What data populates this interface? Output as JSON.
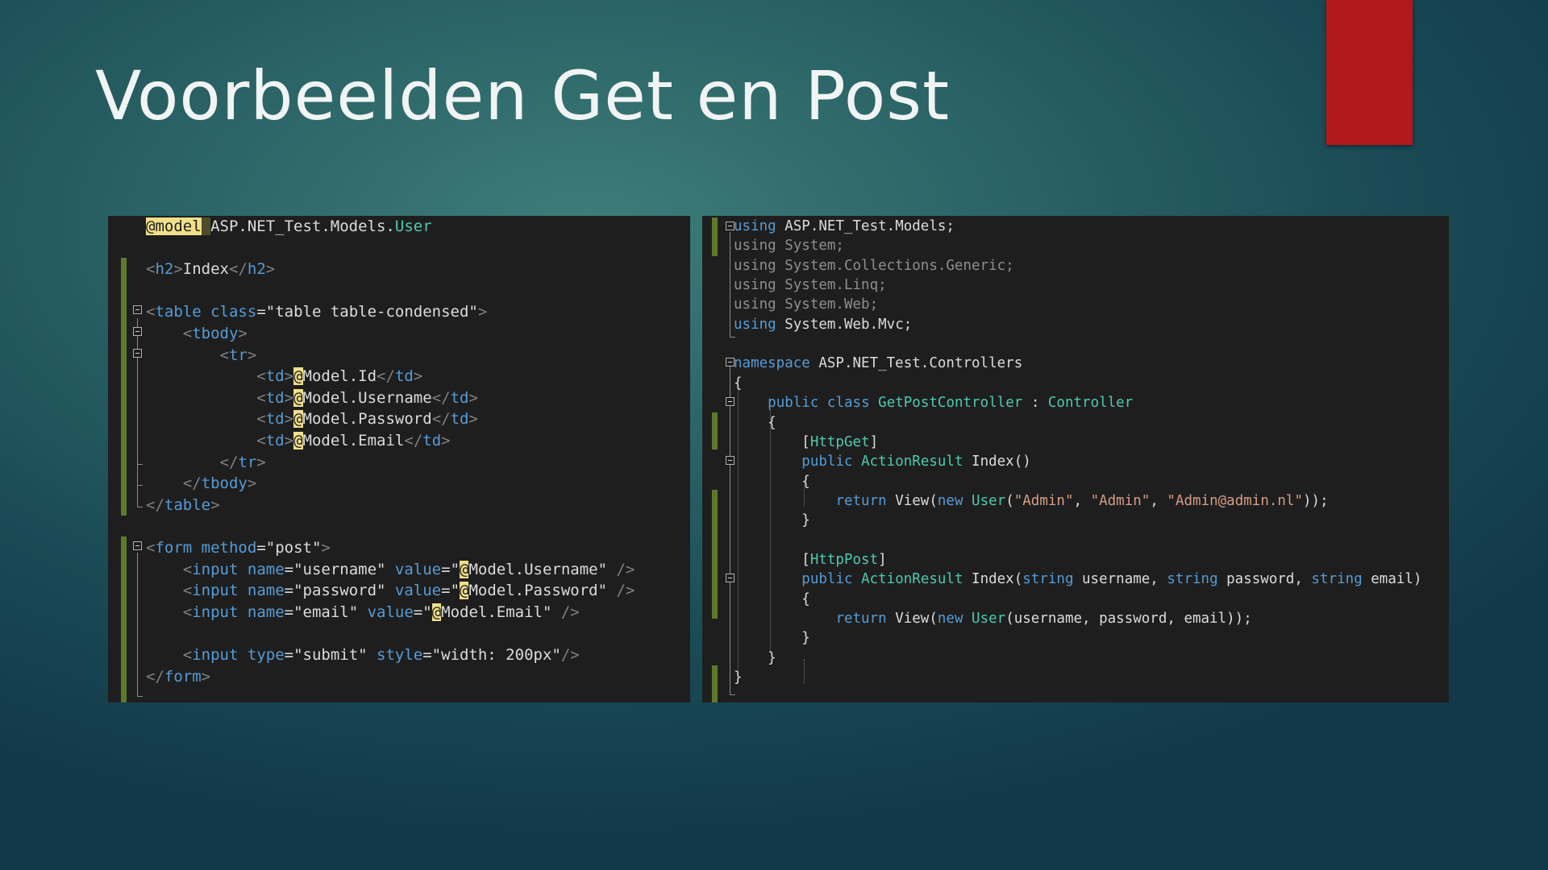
{
  "slide": {
    "title": "Voorbeelden Get en Post"
  },
  "left_code": {
    "lines": [
      {
        "segments": [
          {
            "t": "@model",
            "c": "hl-at"
          },
          {
            "t": " ",
            "c": "hl"
          },
          {
            "t": "ASP.NET_Test.Models.",
            "c": ""
          },
          {
            "t": "User",
            "c": "cls"
          }
        ]
      },
      {
        "segments": []
      },
      {
        "segments": [
          {
            "t": "<",
            "c": "tg"
          },
          {
            "t": "h2",
            "c": "kw"
          },
          {
            "t": ">",
            "c": "tg"
          },
          {
            "t": "Index",
            "c": ""
          },
          {
            "t": "</",
            "c": "tg"
          },
          {
            "t": "h2",
            "c": "kw"
          },
          {
            "t": ">",
            "c": "tg"
          }
        ]
      },
      {
        "segments": []
      },
      {
        "segments": [
          {
            "t": "<",
            "c": "tg"
          },
          {
            "t": "table",
            "c": "kw"
          },
          {
            "t": " ",
            "c": ""
          },
          {
            "t": "class",
            "c": "kw"
          },
          {
            "t": "=\"table table-condensed\"",
            "c": ""
          },
          {
            "t": ">",
            "c": "tg"
          }
        ]
      },
      {
        "segments": [
          {
            "t": "    ",
            "c": ""
          },
          {
            "t": "<",
            "c": "tg"
          },
          {
            "t": "tbody",
            "c": "kw"
          },
          {
            "t": ">",
            "c": "tg"
          }
        ]
      },
      {
        "segments": [
          {
            "t": "        ",
            "c": ""
          },
          {
            "t": "<",
            "c": "tg"
          },
          {
            "t": "tr",
            "c": "kw"
          },
          {
            "t": ">",
            "c": "tg"
          }
        ]
      },
      {
        "segments": [
          {
            "t": "            ",
            "c": ""
          },
          {
            "t": "<",
            "c": "tg"
          },
          {
            "t": "td",
            "c": "kw"
          },
          {
            "t": ">",
            "c": "tg"
          },
          {
            "t": "@",
            "c": "hl-at"
          },
          {
            "t": "Model.Id",
            "c": ""
          },
          {
            "t": "</",
            "c": "tg"
          },
          {
            "t": "td",
            "c": "kw"
          },
          {
            "t": ">",
            "c": "tg"
          }
        ]
      },
      {
        "segments": [
          {
            "t": "            ",
            "c": ""
          },
          {
            "t": "<",
            "c": "tg"
          },
          {
            "t": "td",
            "c": "kw"
          },
          {
            "t": ">",
            "c": "tg"
          },
          {
            "t": "@",
            "c": "hl-at"
          },
          {
            "t": "Model.Username",
            "c": ""
          },
          {
            "t": "</",
            "c": "tg"
          },
          {
            "t": "td",
            "c": "kw"
          },
          {
            "t": ">",
            "c": "tg"
          }
        ]
      },
      {
        "segments": [
          {
            "t": "            ",
            "c": ""
          },
          {
            "t": "<",
            "c": "tg"
          },
          {
            "t": "td",
            "c": "kw"
          },
          {
            "t": ">",
            "c": "tg"
          },
          {
            "t": "@",
            "c": "hl-at"
          },
          {
            "t": "Model.Password",
            "c": ""
          },
          {
            "t": "</",
            "c": "tg"
          },
          {
            "t": "td",
            "c": "kw"
          },
          {
            "t": ">",
            "c": "tg"
          }
        ]
      },
      {
        "segments": [
          {
            "t": "            ",
            "c": ""
          },
          {
            "t": "<",
            "c": "tg"
          },
          {
            "t": "td",
            "c": "kw"
          },
          {
            "t": ">",
            "c": "tg"
          },
          {
            "t": "@",
            "c": "hl-at"
          },
          {
            "t": "Model.Email",
            "c": ""
          },
          {
            "t": "</",
            "c": "tg"
          },
          {
            "t": "td",
            "c": "kw"
          },
          {
            "t": ">",
            "c": "tg"
          }
        ]
      },
      {
        "segments": [
          {
            "t": "        ",
            "c": ""
          },
          {
            "t": "</",
            "c": "tg"
          },
          {
            "t": "tr",
            "c": "kw"
          },
          {
            "t": ">",
            "c": "tg"
          }
        ]
      },
      {
        "segments": [
          {
            "t": "    ",
            "c": ""
          },
          {
            "t": "</",
            "c": "tg"
          },
          {
            "t": "tbody",
            "c": "kw"
          },
          {
            "t": ">",
            "c": "tg"
          }
        ]
      },
      {
        "segments": [
          {
            "t": "</",
            "c": "tg"
          },
          {
            "t": "table",
            "c": "kw"
          },
          {
            "t": ">",
            "c": "tg"
          }
        ]
      },
      {
        "segments": []
      },
      {
        "segments": [
          {
            "t": "<",
            "c": "tg"
          },
          {
            "t": "form",
            "c": "kw"
          },
          {
            "t": " ",
            "c": ""
          },
          {
            "t": "method",
            "c": "kw"
          },
          {
            "t": "=\"post\"",
            "c": ""
          },
          {
            "t": ">",
            "c": "tg"
          }
        ]
      },
      {
        "segments": [
          {
            "t": "    ",
            "c": ""
          },
          {
            "t": "<",
            "c": "tg"
          },
          {
            "t": "input",
            "c": "kw"
          },
          {
            "t": " ",
            "c": ""
          },
          {
            "t": "name",
            "c": "kw"
          },
          {
            "t": "=\"username\" ",
            "c": ""
          },
          {
            "t": "value",
            "c": "kw"
          },
          {
            "t": "=\"",
            "c": ""
          },
          {
            "t": "@",
            "c": "hl-at"
          },
          {
            "t": "Model.Username\" ",
            "c": ""
          },
          {
            "t": "/>",
            "c": "tg"
          }
        ]
      },
      {
        "segments": [
          {
            "t": "    ",
            "c": ""
          },
          {
            "t": "<",
            "c": "tg"
          },
          {
            "t": "input",
            "c": "kw"
          },
          {
            "t": " ",
            "c": ""
          },
          {
            "t": "name",
            "c": "kw"
          },
          {
            "t": "=\"password\" ",
            "c": ""
          },
          {
            "t": "value",
            "c": "kw"
          },
          {
            "t": "=\"",
            "c": ""
          },
          {
            "t": "@",
            "c": "hl-at"
          },
          {
            "t": "Model.Password\" ",
            "c": ""
          },
          {
            "t": "/>",
            "c": "tg"
          }
        ]
      },
      {
        "segments": [
          {
            "t": "    ",
            "c": ""
          },
          {
            "t": "<",
            "c": "tg"
          },
          {
            "t": "input",
            "c": "kw"
          },
          {
            "t": " ",
            "c": ""
          },
          {
            "t": "name",
            "c": "kw"
          },
          {
            "t": "=\"email\" ",
            "c": ""
          },
          {
            "t": "value",
            "c": "kw"
          },
          {
            "t": "=\"",
            "c": ""
          },
          {
            "t": "@",
            "c": "hl-at"
          },
          {
            "t": "Model.Email\" ",
            "c": ""
          },
          {
            "t": "/>",
            "c": "tg"
          }
        ]
      },
      {
        "segments": []
      },
      {
        "segments": [
          {
            "t": "    ",
            "c": ""
          },
          {
            "t": "<",
            "c": "tg"
          },
          {
            "t": "input",
            "c": "kw"
          },
          {
            "t": " ",
            "c": ""
          },
          {
            "t": "type",
            "c": "kw"
          },
          {
            "t": "=\"submit\" ",
            "c": ""
          },
          {
            "t": "style",
            "c": "kw"
          },
          {
            "t": "=\"width: 200px\"",
            "c": ""
          },
          {
            "t": "/>",
            "c": "tg"
          }
        ]
      },
      {
        "segments": [
          {
            "t": "</",
            "c": "tg"
          },
          {
            "t": "form",
            "c": "kw"
          },
          {
            "t": ">",
            "c": "tg"
          }
        ]
      }
    ]
  },
  "right_code": {
    "lines": [
      {
        "segments": [
          {
            "t": "using",
            "c": "kw"
          },
          {
            "t": " ASP.NET_Test.Models;",
            "c": ""
          }
        ]
      },
      {
        "segments": [
          {
            "t": "using System;",
            "c": "dim"
          }
        ]
      },
      {
        "segments": [
          {
            "t": "using System.Collections.Generic;",
            "c": "dim"
          }
        ]
      },
      {
        "segments": [
          {
            "t": "using System.Linq;",
            "c": "dim"
          }
        ]
      },
      {
        "segments": [
          {
            "t": "using System.Web;",
            "c": "dim"
          }
        ]
      },
      {
        "segments": [
          {
            "t": "using",
            "c": "kw"
          },
          {
            "t": " System.Web.Mvc;",
            "c": ""
          }
        ]
      },
      {
        "segments": []
      },
      {
        "segments": [
          {
            "t": "namespace",
            "c": "kw"
          },
          {
            "t": " ASP.NET_Test.Controllers",
            "c": ""
          }
        ]
      },
      {
        "segments": [
          {
            "t": "{",
            "c": ""
          }
        ]
      },
      {
        "segments": [
          {
            "t": "    ",
            "c": ""
          },
          {
            "t": "public",
            "c": "kw"
          },
          {
            "t": " ",
            "c": ""
          },
          {
            "t": "class",
            "c": "kw"
          },
          {
            "t": " ",
            "c": ""
          },
          {
            "t": "GetPostController",
            "c": "cls"
          },
          {
            "t": " : ",
            "c": ""
          },
          {
            "t": "Controller",
            "c": "cls"
          }
        ]
      },
      {
        "segments": [
          {
            "t": "    {",
            "c": ""
          }
        ]
      },
      {
        "segments": [
          {
            "t": "        [",
            "c": ""
          },
          {
            "t": "HttpGet",
            "c": "cls"
          },
          {
            "t": "]",
            "c": ""
          }
        ]
      },
      {
        "segments": [
          {
            "t": "        ",
            "c": ""
          },
          {
            "t": "public",
            "c": "kw"
          },
          {
            "t": " ",
            "c": ""
          },
          {
            "t": "ActionResult",
            "c": "cls"
          },
          {
            "t": " Index()",
            "c": ""
          }
        ]
      },
      {
        "segments": [
          {
            "t": "        {",
            "c": ""
          }
        ]
      },
      {
        "segments": [
          {
            "t": "            ",
            "c": ""
          },
          {
            "t": "return",
            "c": "kw"
          },
          {
            "t": " View(",
            "c": ""
          },
          {
            "t": "new",
            "c": "kw"
          },
          {
            "t": " ",
            "c": ""
          },
          {
            "t": "User",
            "c": "cls"
          },
          {
            "t": "(",
            "c": ""
          },
          {
            "t": "\"Admin\"",
            "c": "str"
          },
          {
            "t": ", ",
            "c": ""
          },
          {
            "t": "\"Admin\"",
            "c": "str"
          },
          {
            "t": ", ",
            "c": ""
          },
          {
            "t": "\"Admin@admin.nl\"",
            "c": "str"
          },
          {
            "t": "));",
            "c": ""
          }
        ]
      },
      {
        "segments": [
          {
            "t": "        }",
            "c": ""
          }
        ]
      },
      {
        "segments": []
      },
      {
        "segments": [
          {
            "t": "        [",
            "c": ""
          },
          {
            "t": "HttpPost",
            "c": "cls"
          },
          {
            "t": "]",
            "c": ""
          }
        ]
      },
      {
        "segments": [
          {
            "t": "        ",
            "c": ""
          },
          {
            "t": "public",
            "c": "kw"
          },
          {
            "t": " ",
            "c": ""
          },
          {
            "t": "ActionResult",
            "c": "cls"
          },
          {
            "t": " Index(",
            "c": ""
          },
          {
            "t": "string",
            "c": "kw"
          },
          {
            "t": " username, ",
            "c": ""
          },
          {
            "t": "string",
            "c": "kw"
          },
          {
            "t": " password, ",
            "c": ""
          },
          {
            "t": "string",
            "c": "kw"
          },
          {
            "t": " email)",
            "c": ""
          }
        ]
      },
      {
        "segments": [
          {
            "t": "        {",
            "c": ""
          }
        ]
      },
      {
        "segments": [
          {
            "t": "            ",
            "c": ""
          },
          {
            "t": "return",
            "c": "kw"
          },
          {
            "t": " View(",
            "c": ""
          },
          {
            "t": "new",
            "c": "kw"
          },
          {
            "t": " ",
            "c": ""
          },
          {
            "t": "User",
            "c": "cls"
          },
          {
            "t": "(username, password, email));",
            "c": ""
          }
        ]
      },
      {
        "segments": [
          {
            "t": "        }",
            "c": ""
          }
        ]
      },
      {
        "segments": [
          {
            "t": "    }",
            "c": ""
          }
        ]
      },
      {
        "segments": [
          {
            "t": "}",
            "c": ""
          }
        ]
      }
    ]
  }
}
